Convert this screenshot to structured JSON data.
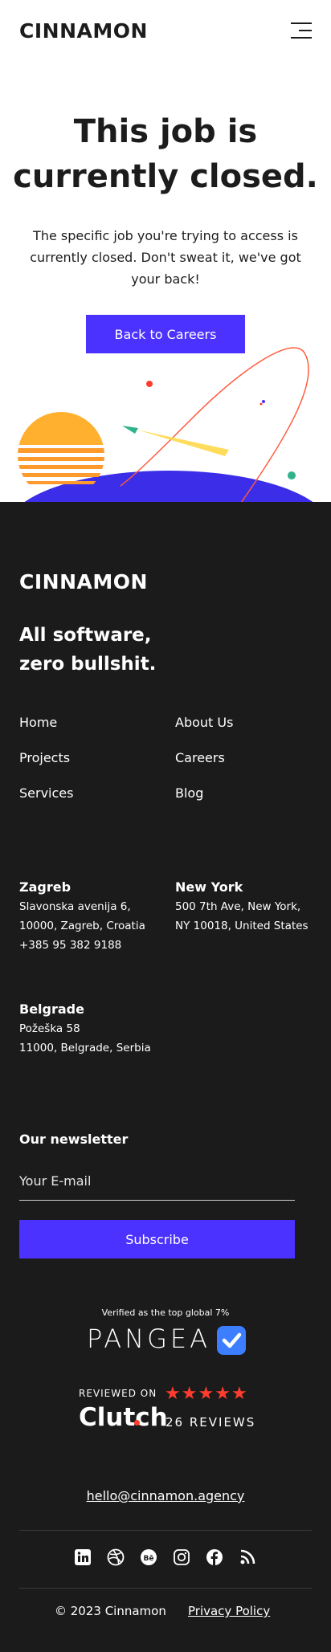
{
  "header": {
    "logo": "CINNAMON",
    "menu_icon": "hamburger-menu-icon"
  },
  "hero": {
    "title_line1": "This job is",
    "title_line2": "currently closed.",
    "text": "The specific job you're trying to access is currently closed. Don't sweat it, we've got your back!",
    "button_label": "Back to Careers"
  },
  "footer": {
    "logo": "CINNAMON",
    "tagline_line1": "All software,",
    "tagline_line2": "zero bullshit.",
    "nav": {
      "home": "Home",
      "projects": "Projects",
      "services": "Services",
      "about": "About Us",
      "careers": "Careers",
      "blog": "Blog"
    },
    "offices": {
      "zagreb": {
        "name": "Zagreb",
        "line1": "Slavonska avenija 6,",
        "line2": "10000, Zagreb, Croatia",
        "phone": "+385 95 382 9188"
      },
      "newyork": {
        "name": "New York",
        "line1": "500 7th Ave, New York,",
        "line2": "NY 10018, United States"
      },
      "belgrade": {
        "name": "Belgrade",
        "line1": "Požeška 58",
        "line2": "11000, Belgrade, Serbia"
      }
    },
    "newsletter": {
      "title": "Our newsletter",
      "placeholder": "Your E-mail",
      "button_label": "Subscribe"
    },
    "pangea": {
      "caption": "Verified as the top global 7%",
      "wordmark": "PANGEA"
    },
    "clutch": {
      "reviewed_on": "REVIEWED ON",
      "wordmark": "Clutch",
      "reviews": "26 REVIEWS",
      "rating_stars": 5
    },
    "email": "hello@cinnamon.agency",
    "socials": [
      "linkedin-icon",
      "dribbble-icon",
      "behance-icon",
      "instagram-icon",
      "facebook-icon",
      "rss-icon"
    ],
    "copyright": "© 2023 Cinnamon",
    "privacy": "Privacy Policy"
  },
  "colors": {
    "accent": "#4c32ff",
    "dark": "#1b1b1b",
    "sun": "#ffab2e",
    "clutch_red": "#ff3d2e",
    "pangea_blue": "#3c7eff"
  }
}
